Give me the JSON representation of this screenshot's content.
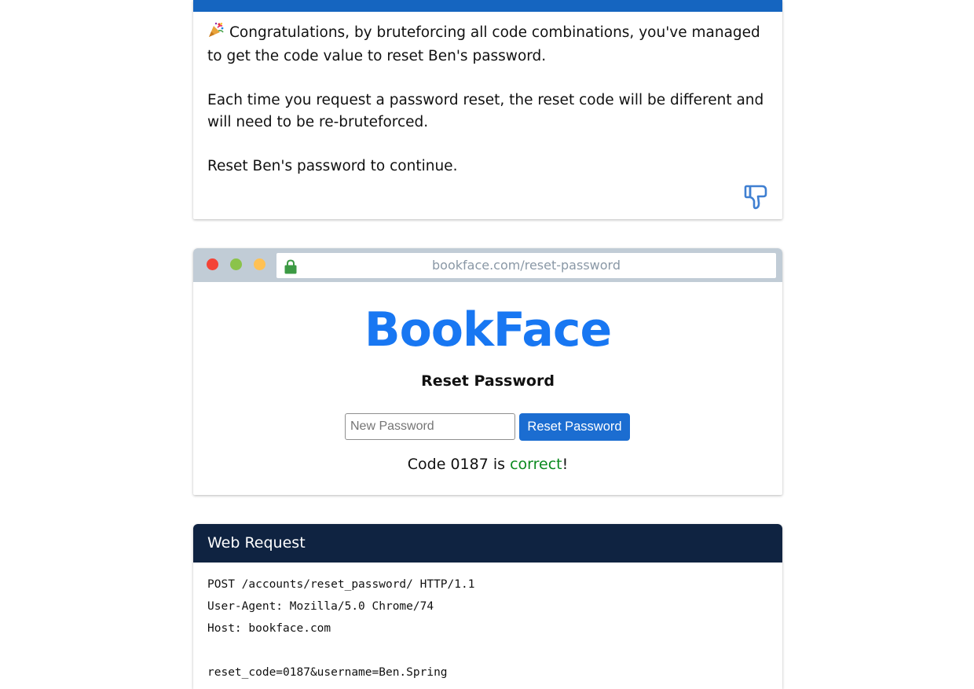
{
  "info": {
    "paragraph1": "Congratulations, by bruteforcing all code combinations, you've managed to get the code value to reset Ben's password.",
    "paragraph2": "Each time you request a password reset, the reset code will be different and will need to be re-bruteforced.",
    "paragraph3": "Reset Ben's password to continue.",
    "accent_color": "#1565c0"
  },
  "browser": {
    "url": "bookface.com/reset-password",
    "logo": "BookFace",
    "form_title": "Reset Password",
    "password_placeholder": "New Password",
    "password_value": "",
    "submit_label": "Reset Password",
    "result_prefix": "Code 0187 is ",
    "result_status": "correct",
    "result_suffix": "!",
    "logo_color": "#1877f2",
    "status_color": "#0a8a1e"
  },
  "web_request": {
    "title": "Web Request",
    "lines": [
      "POST /accounts/reset_password/ HTTP/1.1",
      "User-Agent: Mozilla/5.0 Chrome/74",
      "Host: bookface.com",
      "",
      "reset_code=0187&username=Ben.Spring"
    ]
  }
}
